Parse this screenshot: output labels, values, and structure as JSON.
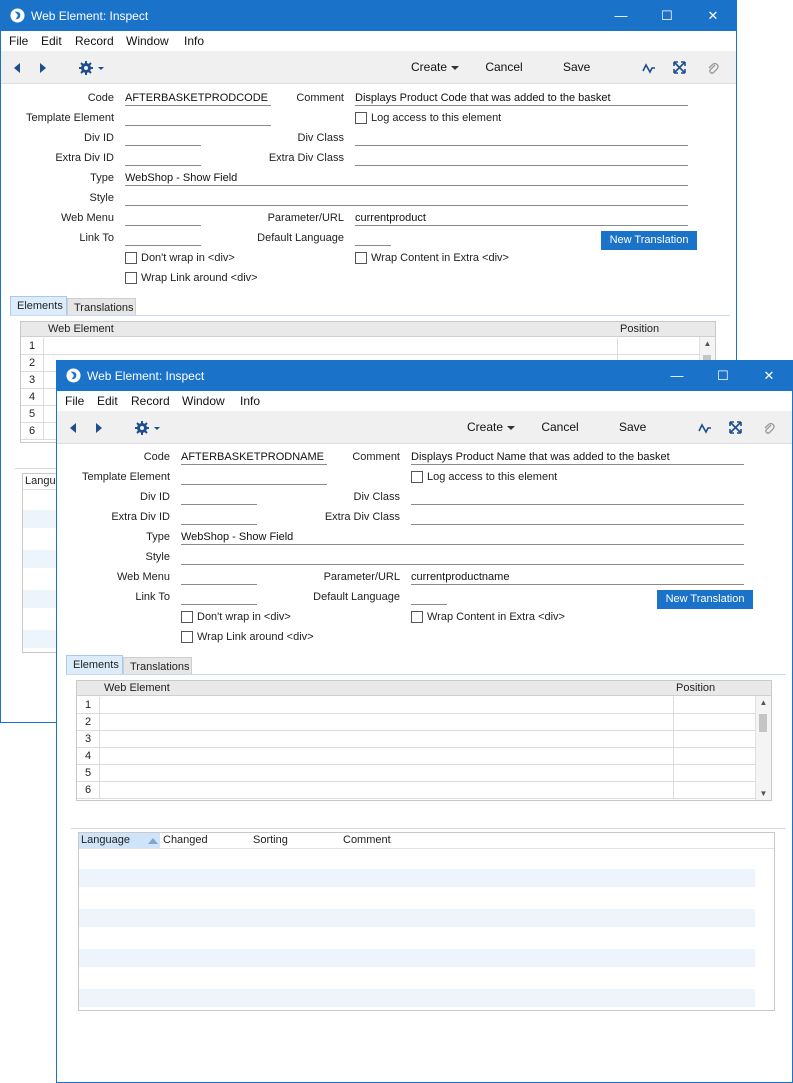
{
  "back": {
    "title": "Web Element: Inspect",
    "menu": [
      "File",
      "Edit",
      "Record",
      "Window",
      "Info"
    ],
    "toolbar": {
      "create": "Create",
      "cancel": "Cancel",
      "save": "Save"
    },
    "labels": {
      "code": "Code",
      "comment": "Comment",
      "template_element": "Template Element",
      "log_access": "Log access to this element",
      "div_id": "Div ID",
      "div_class": "Div Class",
      "extra_div_id": "Extra Div ID",
      "extra_div_class": "Extra Div Class",
      "type": "Type",
      "style": "Style",
      "web_menu": "Web Menu",
      "parameter_url": "Parameter/URL",
      "link_to": "Link To",
      "default_language": "Default Language",
      "dont_wrap": "Don't wrap in <div>",
      "wrap_content": "Wrap Content in Extra <div>",
      "wrap_link": "Wrap Link around <div>",
      "new_translation": "New Translation"
    },
    "values": {
      "code": "AFTERBASKETPRODCODE",
      "comment": "Displays Product Code that was added to the basket",
      "type": "WebShop - Show Field",
      "parameter_url": "currentproduct"
    },
    "tabs": [
      "Elements",
      "Translations"
    ],
    "grid": {
      "col_element": "Web Element",
      "col_position": "Position",
      "rows": [
        "1",
        "2",
        "3",
        "4",
        "5",
        "6"
      ]
    },
    "lang_header_partial": "Langua"
  },
  "front": {
    "title": "Web Element: Inspect",
    "menu": [
      "File",
      "Edit",
      "Record",
      "Window",
      "Info"
    ],
    "toolbar": {
      "create": "Create",
      "cancel": "Cancel",
      "save": "Save"
    },
    "labels": {
      "code": "Code",
      "comment": "Comment",
      "template_element": "Template Element",
      "log_access": "Log access to this element",
      "div_id": "Div ID",
      "div_class": "Div Class",
      "extra_div_id": "Extra Div ID",
      "extra_div_class": "Extra Div Class",
      "type": "Type",
      "style": "Style",
      "web_menu": "Web Menu",
      "parameter_url": "Parameter/URL",
      "link_to": "Link To",
      "default_language": "Default Language",
      "dont_wrap": "Don't wrap in <div>",
      "wrap_content": "Wrap Content in Extra <div>",
      "wrap_link": "Wrap Link around <div>",
      "new_translation": "New Translation"
    },
    "values": {
      "code": "AFTERBASKETPRODNAME",
      "comment": "Displays Product Name that was added to the basket",
      "type": "WebShop - Show Field",
      "parameter_url": "currentproductname"
    },
    "tabs": [
      "Elements",
      "Translations"
    ],
    "grid": {
      "col_element": "Web Element",
      "col_position": "Position",
      "rows": [
        "1",
        "2",
        "3",
        "4",
        "5",
        "6"
      ]
    },
    "lang_list": {
      "columns": [
        "Language",
        "Changed",
        "Sorting",
        "Comment"
      ]
    }
  }
}
